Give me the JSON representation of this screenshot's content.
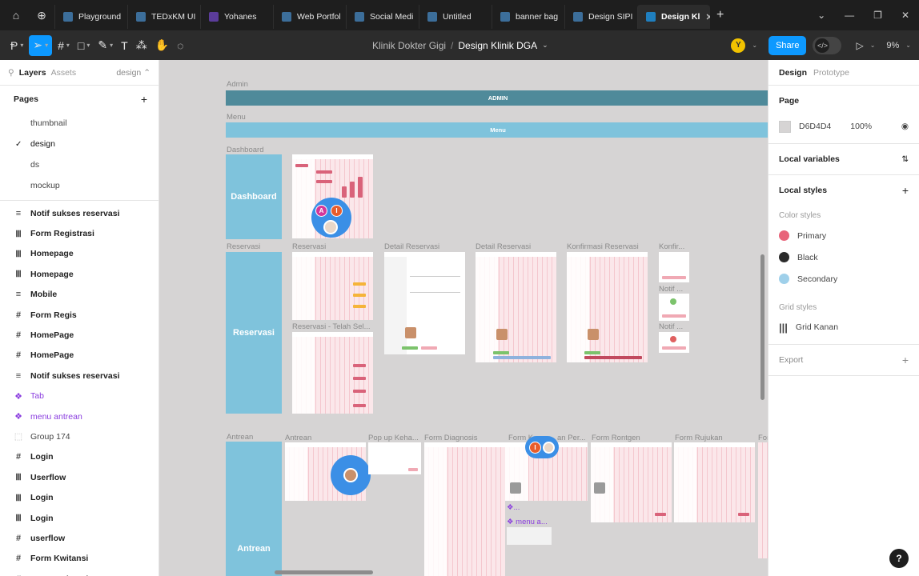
{
  "browser_tabs": [
    {
      "label": "Playground",
      "color": "#3c6e9a"
    },
    {
      "label": "TEDxKM UI",
      "color": "#3c6e9a"
    },
    {
      "label": "Yohanes",
      "color": "#5b3c9a"
    },
    {
      "label": "Web Portfol",
      "color": "#3c6e9a"
    },
    {
      "label": "Social Medi",
      "color": "#3c6e9a"
    },
    {
      "label": "Untitled",
      "color": "#3c6e9a"
    },
    {
      "label": "banner bag",
      "color": "#3c6e9a"
    },
    {
      "label": "Design SIPI",
      "color": "#3c6e9a"
    },
    {
      "label": "Design Kl",
      "color": "#1f7fbf",
      "active": true
    }
  ],
  "toolbar": {
    "project": "Klinik Dokter Gigi",
    "separator": "/",
    "file": "Design Klinik DGA",
    "user_initial": "Y",
    "share_label": "Share",
    "dev_icon": "</>",
    "zoom": "9%"
  },
  "left_panel": {
    "tab_layers": "Layers",
    "tab_assets": "Assets",
    "page_selector": "design",
    "pages_title": "Pages",
    "pages": [
      {
        "name": "thumbnail",
        "current": false
      },
      {
        "name": "design",
        "current": true
      },
      {
        "name": "ds",
        "current": false
      },
      {
        "name": "mockup",
        "current": false
      }
    ],
    "layers": [
      {
        "name": "Notif sukses reservasi",
        "type": "rows"
      },
      {
        "name": "Form Registrasi",
        "type": "cols"
      },
      {
        "name": "Homepage",
        "type": "cols"
      },
      {
        "name": "Homepage",
        "type": "cols"
      },
      {
        "name": "Mobile",
        "type": "rows"
      },
      {
        "name": "Form Regis",
        "type": "frame"
      },
      {
        "name": "HomePage",
        "type": "frame"
      },
      {
        "name": "HomePage",
        "type": "frame"
      },
      {
        "name": "Notif sukses reservasi",
        "type": "rows"
      },
      {
        "name": "Tab",
        "type": "component"
      },
      {
        "name": "menu antrean",
        "type": "component"
      },
      {
        "name": "Group 174",
        "type": "group"
      },
      {
        "name": "Login",
        "type": "frame"
      },
      {
        "name": "Userflow",
        "type": "cols"
      },
      {
        "name": "Login",
        "type": "cols"
      },
      {
        "name": "Login",
        "type": "cols"
      },
      {
        "name": "userflow",
        "type": "frame"
      },
      {
        "name": "Form Kwitansi",
        "type": "frame"
      },
      {
        "name": "Form Kwitansi",
        "type": "frame"
      }
    ]
  },
  "right_panel": {
    "tab_design": "Design",
    "tab_prototype": "Prototype",
    "page_title": "Page",
    "page_bg_hex": "D6D4D4",
    "page_bg_opacity": "100%",
    "local_variables": "Local variables",
    "local_styles": "Local styles",
    "color_styles_title": "Color styles",
    "color_styles": [
      {
        "name": "Primary",
        "color": "#e8647a"
      },
      {
        "name": "Black",
        "color": "#2b2b2b"
      },
      {
        "name": "Secondary",
        "color": "#9fd0ea"
      }
    ],
    "grid_styles_title": "Grid styles",
    "grid_styles": [
      {
        "name": "Grid Kanan"
      }
    ],
    "export": "Export",
    "help": "?"
  },
  "canvas": {
    "labels": {
      "admin": "Admin",
      "admin_bar": "ADMIN",
      "menu": "Menu",
      "menu_bar": "Menu",
      "dashboard": "Dashboard",
      "dashboard_block": "Dashboard",
      "reservasi": "Reservasi",
      "reservasi_block": "Reservasi",
      "antrean": "Antrean",
      "antrean_block": "Antrean"
    },
    "reservasi_frames": [
      "Reservasi",
      "Detail Reservasi",
      "Detail Reservasi",
      "Konfirmasi Reservasi",
      "Konfir...",
      "Reservasi - Telah Sel...",
      "Notif ...",
      "Notif ..."
    ],
    "antrean_frames": [
      "Antrean",
      "Pop up Keha...",
      "Form Diagnosis",
      "Form K",
      "an Per...",
      "Form Rontgen",
      "Form Rujukan",
      "For"
    ],
    "component_labels": [
      "❖...",
      "❖ menu a..."
    ],
    "avatars": [
      {
        "initial": "A",
        "color": "#d3379a"
      },
      {
        "initial": "I",
        "color": "#e85d2c"
      }
    ],
    "colors": {
      "admin_bar": "#4f8a9a",
      "menu_bar": "#7fc3dc",
      "section_block": "#7fc3dc",
      "cursor": "#3b8fe6"
    }
  }
}
